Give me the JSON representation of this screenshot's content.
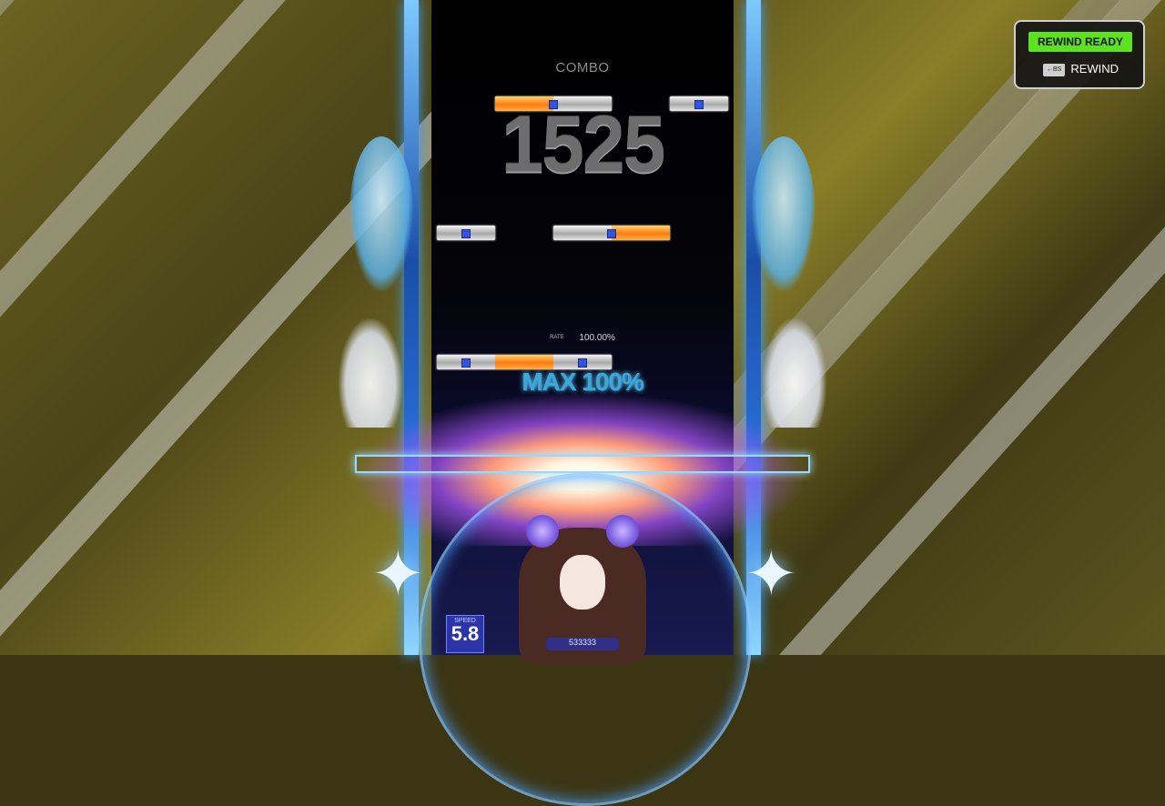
{
  "hud": {
    "combo_label": "COMBO",
    "combo_count": "1525",
    "rate_label": "RATE",
    "rate_value": "100.00%",
    "max_text": "MAX 100%",
    "speed_label": "SPEED",
    "speed_value": "5.8",
    "score": "533333"
  },
  "rewind": {
    "status": "REWIND READY",
    "key_hint": "←BS",
    "action_label": "REWIND"
  },
  "notes": [
    {
      "lane_start": 1,
      "lane_span": 2,
      "style": "orange-white"
    },
    {
      "lane_start": 4,
      "lane_span": 1,
      "style": "white"
    },
    {
      "lane_start": 0,
      "lane_span": 1,
      "style": "white"
    },
    {
      "lane_start": 2,
      "lane_span": 2,
      "style": "white-orange"
    },
    {
      "lane_start": 0,
      "lane_span": 3,
      "style": "white-orange-white"
    }
  ],
  "colors": {
    "accent_green": "#5ce21e",
    "lane_blue": "#2a6fd8",
    "note_orange": "#ff7a14"
  }
}
